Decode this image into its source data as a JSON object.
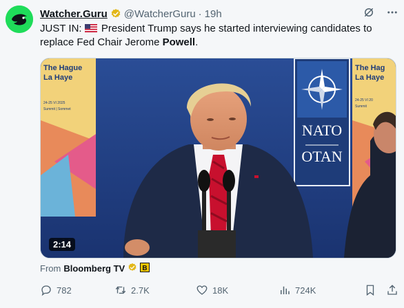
{
  "tweet": {
    "author_name": "Watcher.Guru",
    "handle": "@WatcherGuru",
    "separator": "·",
    "time": "19h",
    "text_prefix": "JUST IN: ",
    "text_main": " President Trump says he started interviewing candidates to replace Fed Chair Jerome ",
    "text_bold": "Powell",
    "text_suffix": ".",
    "media_duration": "2:14",
    "media_banner_left_line1": "The Hague",
    "media_banner_left_line2": "La Haye",
    "media_banner_left_date": "24-25 VI 2025",
    "media_banner_left_sub": "Summit | Sommet",
    "media_banner_right_line1": "The Hag",
    "media_banner_right_line2": "La Haye",
    "media_banner_right_date": "24-25 VI 20",
    "media_banner_right_sub": "Summit",
    "nato_line1": "NATO",
    "nato_line2": "OTAN",
    "from_label": "From",
    "from_source": "Bloomberg TV",
    "from_badge": "B"
  },
  "actions": {
    "replies": "782",
    "reposts": "2.7K",
    "likes": "18K",
    "views": "724K"
  },
  "colors": {
    "avatar_bg": "#1fdc5a",
    "verified": "#e2b719",
    "nato_blue": "#1e3c79"
  }
}
